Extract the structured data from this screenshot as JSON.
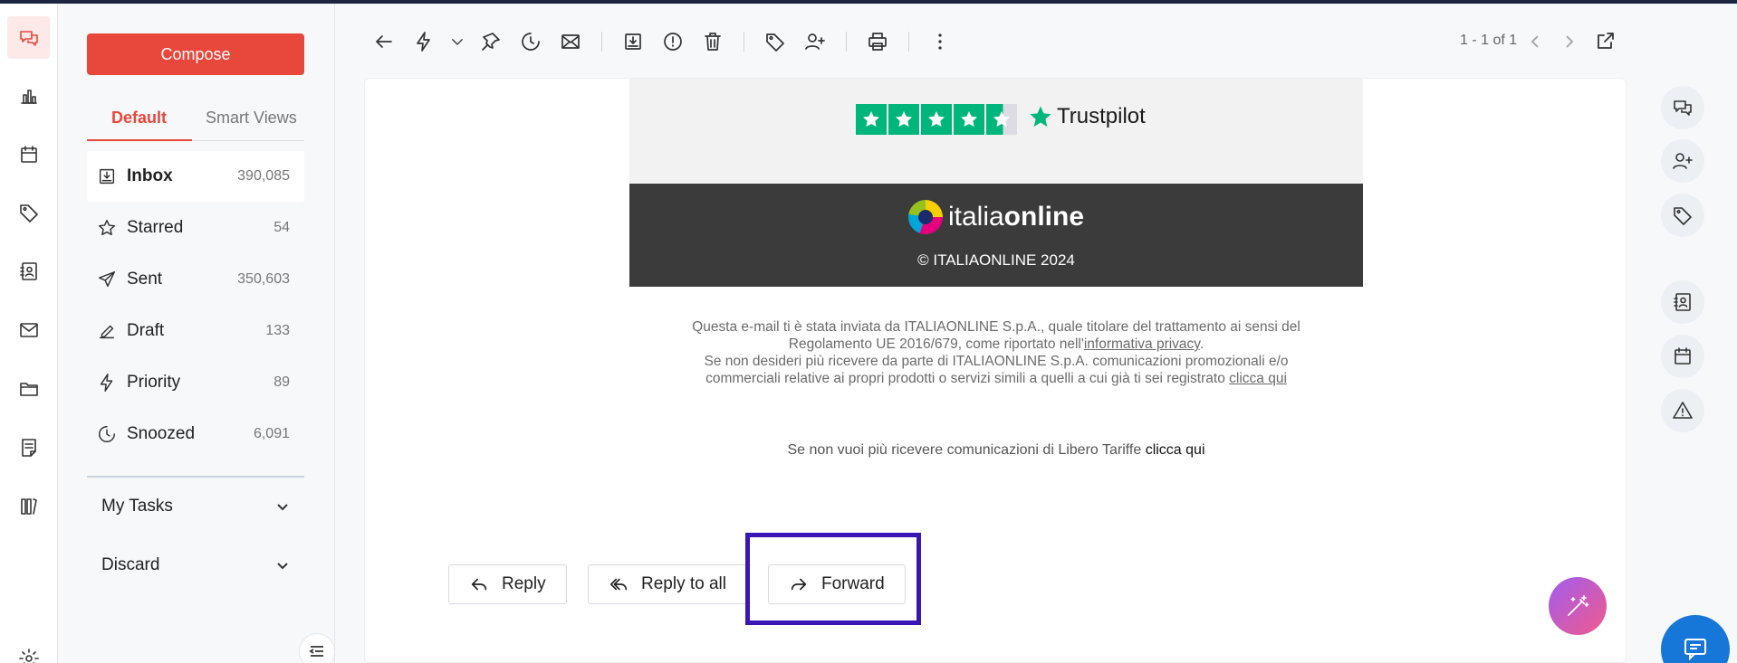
{
  "rail": {
    "items": [
      {
        "icon": "chat-bubbles-icon",
        "active": true
      },
      {
        "icon": "bar-chart-icon"
      },
      {
        "icon": "calendar-icon"
      },
      {
        "icon": "tag-icon"
      },
      {
        "icon": "contacts-icon"
      },
      {
        "icon": "mail-icon"
      },
      {
        "icon": "folder-icon"
      },
      {
        "icon": "notes-icon"
      },
      {
        "icon": "tools-icon"
      },
      {
        "icon": "settings-icon"
      }
    ]
  },
  "sidebar": {
    "compose_label": "Compose",
    "tabs": [
      {
        "label": "Default",
        "active": true
      },
      {
        "label": "Smart Views"
      }
    ],
    "folders": [
      {
        "name": "Inbox",
        "count": "390,085",
        "icon": "inbox-icon",
        "selected": true
      },
      {
        "name": "Starred",
        "count": "54",
        "icon": "star-icon"
      },
      {
        "name": "Sent",
        "count": "350,603",
        "icon": "send-icon"
      },
      {
        "name": "Draft",
        "count": "133",
        "icon": "draft-icon"
      },
      {
        "name": "Priority",
        "count": "89",
        "icon": "bolt-icon"
      },
      {
        "name": "Snoozed",
        "count": "6,091",
        "icon": "snooze-icon"
      }
    ],
    "sections": [
      {
        "label": "My Tasks"
      },
      {
        "label": "Discard"
      }
    ]
  },
  "toolbar": {
    "pager": "1 - 1 of 1",
    "icons": [
      "back-arrow-icon",
      "bolt-icon",
      "chevron-down-icon",
      "pin-icon",
      "snooze-icon",
      "mark-unread-icon",
      "archive-icon",
      "spam-icon",
      "trash-icon",
      "tag-icon",
      "add-contact-icon",
      "print-icon",
      "more-vertical-icon"
    ]
  },
  "email": {
    "trustpilot_label": "Trustpilot",
    "trustpilot_rating": 4.5,
    "brand_light": "italia",
    "brand_bold": "online",
    "copyright": "© ITALIAONLINE 2024",
    "legal_line1": "Questa e-mail ti è stata inviata da ITALIAONLINE S.p.A., quale titolare del trattamento ai sensi del",
    "legal_line2_prefix": "Regolamento UE 2016/679, come riportato nell'",
    "legal_privacy_link": "informativa privacy",
    "legal_line2_suffix": ".",
    "legal_line3": "Se non desideri più ricevere da parte di ITALIAONLINE S.p.A. comunicazioni promozionali e/o",
    "legal_line4_prefix": "commerciali relative ai propri prodotti o servizi simili a quelli a cui già ti sei registrato ",
    "legal_click_link": "clicca qui",
    "unsub_text": "Se non vuoi più ricevere comunicazioni di Libero Tariffe ",
    "unsub_link": "clicca qui"
  },
  "actions": {
    "reply": "Reply",
    "reply_all": "Reply to all",
    "forward": "Forward"
  },
  "right_rail": {
    "icons": [
      "chat-icon",
      "add-contact-icon",
      "tag-icon",
      "contact-card-icon",
      "calendar-icon",
      "warning-icon"
    ]
  },
  "colors": {
    "accent": "#e8473c",
    "highlight": "#3a16b7",
    "trustpilot_green": "#00b67a",
    "chat_fab": "#1677d9"
  }
}
